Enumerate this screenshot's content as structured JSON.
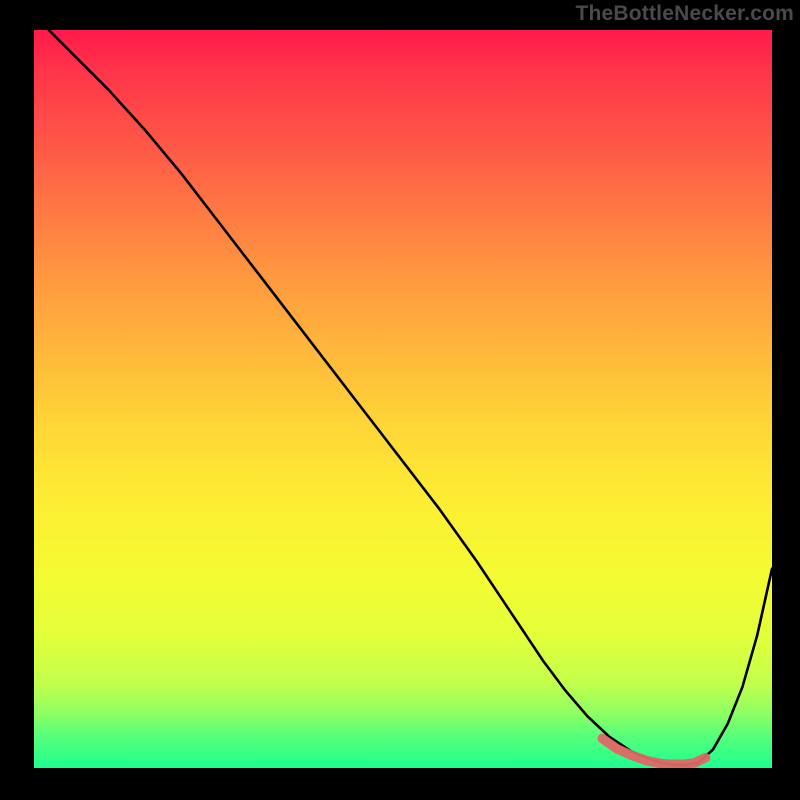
{
  "watermark": "TheBottleNecker.com",
  "colors": {
    "background": "#000000",
    "curve": "#000000",
    "highlight": "#e06666"
  },
  "chart_data": {
    "type": "line",
    "title": "",
    "xlabel": "",
    "ylabel": "",
    "xlim": [
      0,
      100
    ],
    "ylim": [
      0,
      100
    ],
    "series": [
      {
        "name": "bottleneck-curve",
        "x": [
          2,
          6,
          10,
          15,
          20,
          25,
          30,
          35,
          40,
          45,
          50,
          55,
          60,
          63,
          66,
          69,
          72,
          75,
          78,
          81,
          84,
          86,
          88,
          90,
          92,
          94,
          96,
          98,
          100
        ],
        "y": [
          100,
          96,
          92,
          86.5,
          80.5,
          74,
          67.5,
          61,
          54.5,
          48,
          41.5,
          35,
          28,
          23.5,
          19,
          14.5,
          10.5,
          7,
          4.2,
          2.2,
          1,
          0.5,
          0.4,
          0.7,
          2.5,
          6,
          11,
          18,
          27
        ]
      },
      {
        "name": "optimal-range",
        "x": [
          77,
          79,
          81,
          83,
          85,
          86.5,
          88,
          89.5,
          91
        ],
        "y": [
          4.0,
          2.6,
          1.7,
          1.0,
          0.6,
          0.5,
          0.5,
          0.7,
          1.4
        ]
      }
    ],
    "gradient_note": "Background indicates bottleneck severity: red (high) at top to green (low/ideal) at bottom; curve shows bottleneck % vs configuration, valley = best match"
  }
}
